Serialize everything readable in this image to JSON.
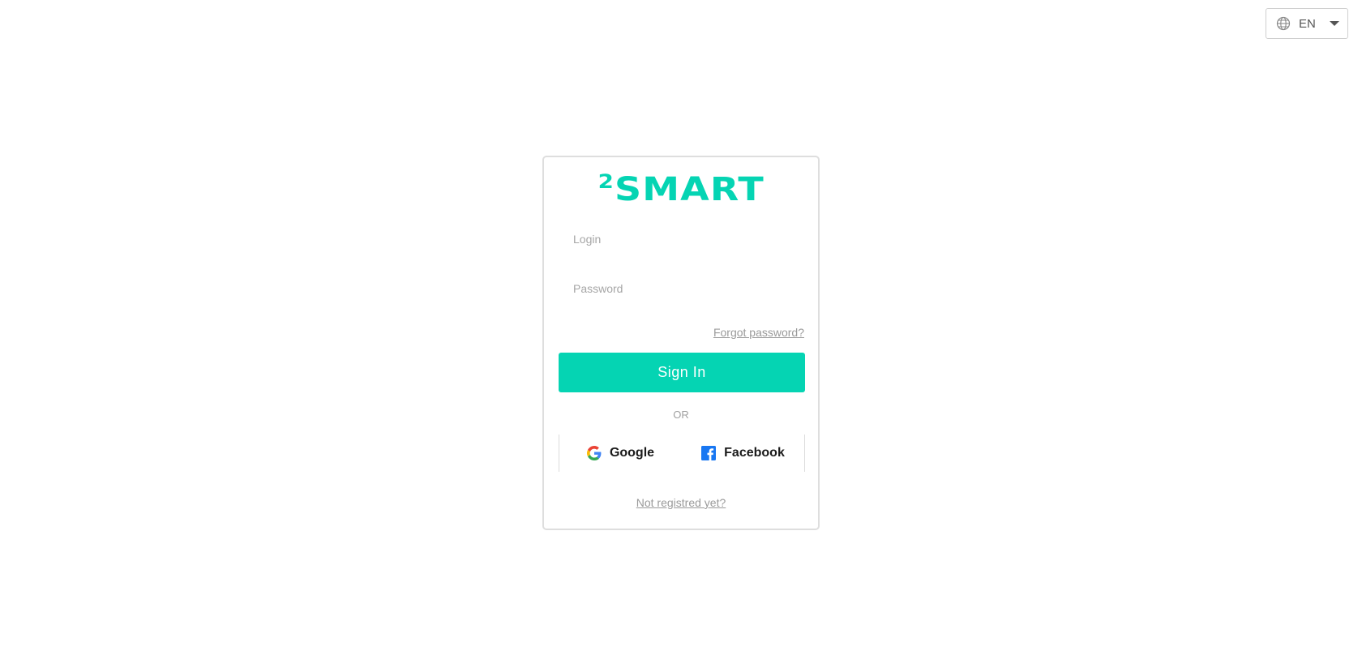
{
  "language_switcher": {
    "icon": "globe-icon",
    "selected": "EN",
    "chevron": "chevron-down-icon"
  },
  "login_card": {
    "logo": {
      "superscript": "2",
      "text": "SMART",
      "color": "#05d4b3"
    },
    "login_input": {
      "placeholder": "Login",
      "value": ""
    },
    "password_input": {
      "placeholder": "Password",
      "value": ""
    },
    "forgot_password_label": "Forgot password?",
    "sign_in_label": "Sign In",
    "or_label": "OR",
    "social": {
      "google_label": "Google",
      "google_icon": "google-icon",
      "facebook_label": "Facebook",
      "facebook_icon": "facebook-icon"
    },
    "register_label": "Not registred yet?"
  },
  "colors": {
    "accent": "#05d4b3",
    "muted_text": "#9a9a9a",
    "facebook_blue": "#1877f2"
  }
}
